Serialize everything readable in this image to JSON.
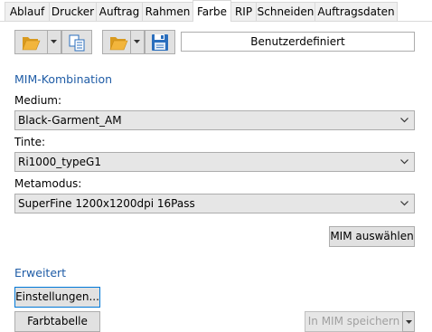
{
  "tabs": [
    {
      "label": "Ablauf",
      "active": false
    },
    {
      "label": "Drucker",
      "active": false
    },
    {
      "label": "Auftrag",
      "active": false
    },
    {
      "label": "Rahmen",
      "active": false
    },
    {
      "label": "Farbe",
      "active": true
    },
    {
      "label": "RIP",
      "active": false
    },
    {
      "label": "Schneiden",
      "active": false
    },
    {
      "label": "Auftragsdaten",
      "active": false
    }
  ],
  "toolbar": {
    "icons": [
      "open-folder-icon",
      "copy-files-icon",
      "open-folder-icon",
      "save-disk-icon"
    ],
    "preset_value": "Benutzerdefiniert"
  },
  "mim": {
    "section_title": "MIM-Kombination",
    "medium_label": "Medium:",
    "medium_value": "Black-Garment_AM",
    "ink_label": "Tinte:",
    "ink_value": "Ri1000_typeG1",
    "meta_label": "Metamodus:",
    "meta_value": "SuperFine 1200x1200dpi 16Pass",
    "select_button": "MIM auswählen"
  },
  "advanced": {
    "section_title": "Erweitert",
    "settings_button": "Einstellungen...",
    "color_table_button": "Farbtabelle",
    "save_in_mim_button": "In MIM speichern"
  },
  "colors": {
    "accent": "#1f5ca6",
    "focus_border": "#0078d7",
    "folder": "#f2b53c",
    "disk": "#2a6ebd"
  }
}
